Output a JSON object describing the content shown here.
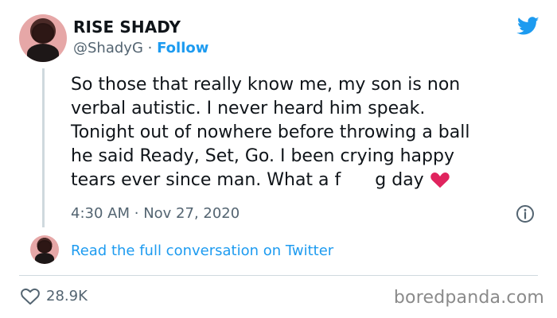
{
  "tweet": {
    "display_name": "RISE SHADY",
    "handle": "@ShadyG",
    "separator": "·",
    "follow_label": "Follow",
    "text_line_1": "So those that really know me, my son is non",
    "text_line_2": "verbal autistic. I never heard him speak.",
    "text_line_3": "Tonight out of nowhere before throwing a ball",
    "text_line_4": "he said Ready, Set, Go. I been crying happy",
    "text_line_5_before": "tears ever since man. What a f",
    "text_line_5_after": "g day",
    "time": "4:30 AM",
    "meta_separator": "·",
    "date": "Nov 27, 2020"
  },
  "reply": {
    "label": "Read the full conversation on Twitter"
  },
  "footer": {
    "likes_count": "28.9K",
    "watermark": "boredpanda.com"
  },
  "icons": {
    "platform": "twitter-bird-icon",
    "info": "info-icon",
    "like": "heart-outline-icon",
    "emoji": "red-heart-icon"
  },
  "colors": {
    "accent": "#1d9bf0",
    "text": "#0f1419",
    "muted": "#536471",
    "heart": "#e0245e"
  }
}
